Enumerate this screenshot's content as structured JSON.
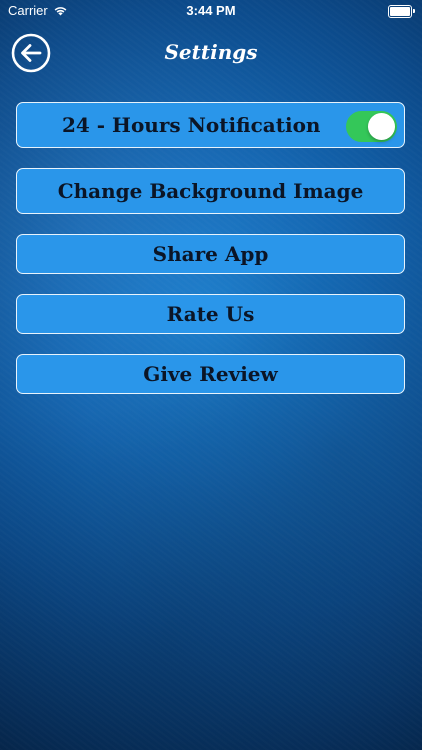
{
  "status_bar": {
    "carrier": "Carrier",
    "time": "3:44 PM"
  },
  "nav": {
    "title": "Settings",
    "back_icon": "arrow-left-circle-icon"
  },
  "settings": {
    "notification": {
      "label": "24 - Hours Notification",
      "enabled": true
    },
    "change_background": "Change Background Image",
    "share_app": "Share App",
    "rate_us": "Rate Us",
    "give_review": "Give Review"
  },
  "colors": {
    "button_fill": "#2a96ea",
    "button_border": "#e8f3fc",
    "button_text": "#0b1526",
    "toggle_on": "#34c759",
    "background": "#1467b3"
  }
}
